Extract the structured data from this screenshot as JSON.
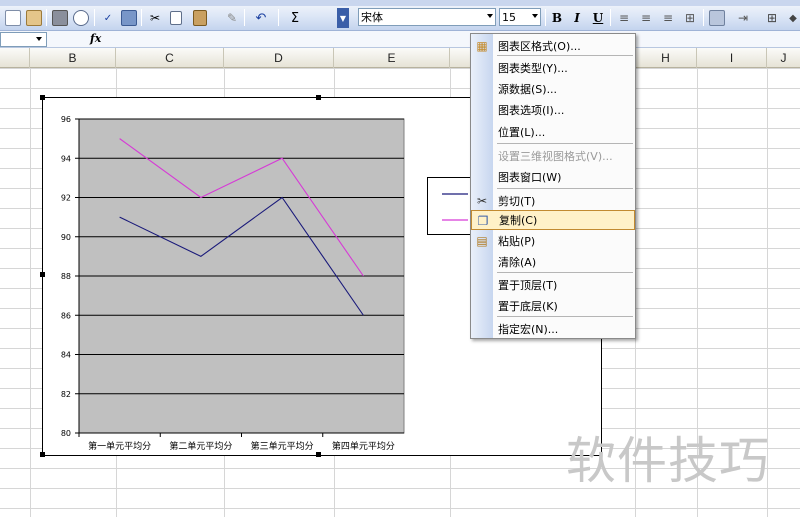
{
  "toolbar": {
    "font_name": "宋体",
    "font_size": "15",
    "bold_label": "B",
    "italic_label": "I",
    "underline_label": "U",
    "sum_label": "Σ",
    "fx_label": "fx"
  },
  "columns": [
    "B",
    "C",
    "D",
    "E",
    "H",
    "I",
    "J"
  ],
  "chart_data": {
    "type": "line",
    "categories": [
      "第一单元平均分",
      "第二单元平均分",
      "第三单元平均分",
      "第四单元平均分"
    ],
    "series": [
      {
        "values": [
          91,
          89,
          92,
          86
        ],
        "color": "#1a1a7a"
      },
      {
        "values": [
          95,
          92,
          94,
          88
        ],
        "color": "#d63ad6"
      }
    ],
    "ylim": [
      80,
      96
    ],
    "yticks": [
      "80",
      "82",
      "84",
      "86",
      "88",
      "90",
      "92",
      "94",
      "96"
    ],
    "plot_background": "#c0c0c0",
    "grid": true,
    "legend": "right"
  },
  "context_menu": {
    "items": [
      {
        "label": "图表区格式(O)...",
        "icon": "chart-format-icon",
        "enabled": true,
        "highlighted": false
      },
      {
        "label": "图表类型(Y)...",
        "icon": "",
        "enabled": true,
        "highlighted": false
      },
      {
        "label": "源数据(S)...",
        "icon": "",
        "enabled": true,
        "highlighted": false
      },
      {
        "label": "图表选项(I)...",
        "icon": "",
        "enabled": true,
        "highlighted": false
      },
      {
        "label": "位置(L)...",
        "icon": "",
        "enabled": true,
        "highlighted": false
      },
      {
        "label": "设置三维视图格式(V)...",
        "icon": "",
        "enabled": false,
        "highlighted": false
      },
      {
        "label": "图表窗口(W)",
        "icon": "",
        "enabled": true,
        "highlighted": false
      },
      {
        "label": "剪切(T)",
        "icon": "scissors-icon",
        "enabled": true,
        "highlighted": false
      },
      {
        "label": "复制(C)",
        "icon": "copy-icon",
        "enabled": true,
        "highlighted": true
      },
      {
        "label": "粘贴(P)",
        "icon": "paste-icon",
        "enabled": true,
        "highlighted": false
      },
      {
        "label": "清除(A)",
        "icon": "",
        "enabled": true,
        "highlighted": false
      },
      {
        "label": "置于顶层(T)",
        "icon": "",
        "enabled": true,
        "highlighted": false
      },
      {
        "label": "置于底层(K)",
        "icon": "",
        "enabled": true,
        "highlighted": false
      },
      {
        "label": "指定宏(N)...",
        "icon": "",
        "enabled": true,
        "highlighted": false
      }
    ]
  },
  "watermark": "软件技巧"
}
